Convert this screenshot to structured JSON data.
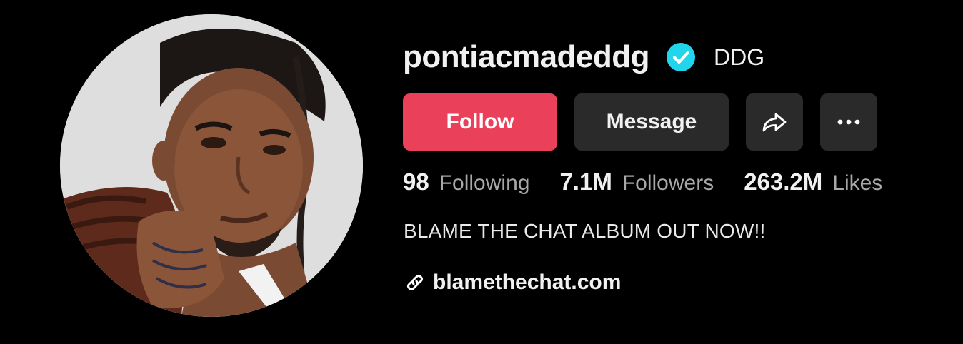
{
  "profile": {
    "username": "pontiacmadeddg",
    "nickname": "DDG",
    "verified": true
  },
  "actions": {
    "follow_label": "Follow",
    "message_label": "Message",
    "share_icon": "share-icon",
    "more_icon": "more-icon"
  },
  "stats": [
    {
      "value": "98",
      "label": "Following"
    },
    {
      "value": "7.1M",
      "label": "Followers"
    },
    {
      "value": "263.2M",
      "label": "Likes"
    }
  ],
  "bio": "BLAME THE CHAT ALBUM OUT NOW!!",
  "link": {
    "icon": "link-icon",
    "text": "blamethechat.com"
  },
  "colors": {
    "background": "#000000",
    "follow_button": "#ea4059",
    "secondary_button": "#2a2a2a",
    "verified_badge": "#20d5ec",
    "label_gray": "#a8a8a8"
  }
}
